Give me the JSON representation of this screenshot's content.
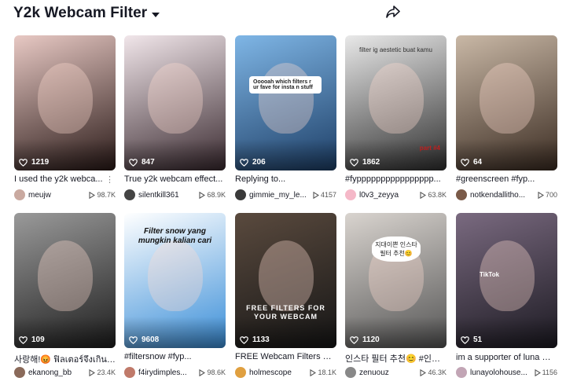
{
  "header": {
    "title": "Y2k Webcam Filter",
    "share_icon": "share-icon",
    "caret_icon": "chevron-down-icon"
  },
  "videos": [
    {
      "caption": "I used the y2k webca...",
      "author": "meujw",
      "views": "98.7K",
      "likes": "1219",
      "overlay": "",
      "colors": [
        "#e8c9c4",
        "#2a1a18"
      ],
      "avatar": "#c9a9a0"
    },
    {
      "caption": "True y2k webcam effect...",
      "author": "silentkill361",
      "views": "68.9K",
      "likes": "847",
      "overlay": "",
      "colors": [
        "#f1e6ea",
        "#3a2a30"
      ],
      "avatar": "#444"
    },
    {
      "caption": "Replying to...",
      "author": "gimmie_my_le...",
      "views": "4157",
      "likes": "206",
      "overlay": "Ooooah which filters r ur fave for insta n stuff",
      "colors": [
        "#7fb6e6",
        "#1d3e66"
      ],
      "avatar": "#3a3a3a"
    },
    {
      "caption": "#fypppppppppppppppp...",
      "author": "l0v3_zeyya",
      "views": "63.8K",
      "likes": "1862",
      "overlay": "filter ig aestetic buat kamu",
      "overlay2": "part #4",
      "colors": [
        "#e9e9e9",
        "#303030"
      ],
      "avatar": "#f5b8c8"
    },
    {
      "caption": "#greenscreen #fyp...",
      "author": "notkendallitho...",
      "views": "700",
      "likes": "64",
      "overlay": "",
      "colors": [
        "#c9b8a6",
        "#3b2c22"
      ],
      "avatar": "#7a5a48"
    },
    {
      "caption": "사랑해!😡 ฟิลเตอร์จึงเกินไ...",
      "author": "ekanong_bb",
      "views": "23.4K",
      "likes": "109",
      "overlay": "",
      "colors": [
        "#9a9a9a",
        "#1e1e1e"
      ],
      "avatar": "#8a6a5a"
    },
    {
      "caption": "#filtersnow #fyp...",
      "author": "f4irydimples...",
      "views": "98.6K",
      "likes": "9608",
      "overlay": "Filter snow yang mungkin kalian cari",
      "colors": [
        "#ffffff",
        "#3a8ed8"
      ],
      "avatar": "#c07a6a"
    },
    {
      "caption": "FREE Webcam Filters For...",
      "author": "holmescope",
      "views": "18.1K",
      "likes": "1133",
      "overlay": "FREE FILTERS FOR YOUR WEBCAM",
      "colors": [
        "#5a4a3e",
        "#161616"
      ],
      "avatar": "#e0a040"
    },
    {
      "caption": "인스타 필터 추천😊 #인스...",
      "author": "zenuouz",
      "views": "46.3K",
      "likes": "1120",
      "overlay": "지대이쁜 인스타 필터 추천😊",
      "colors": [
        "#d9d4cf",
        "#555"
      ],
      "avatar": "#888"
    },
    {
      "caption": "im a supporter of luna 😊...",
      "author": "lunayolohouse...",
      "views": "1156",
      "likes": "51",
      "overlay": "TikTok",
      "colors": [
        "#7a6a80",
        "#1c1a22"
      ],
      "avatar": "#c2a5b5"
    }
  ]
}
